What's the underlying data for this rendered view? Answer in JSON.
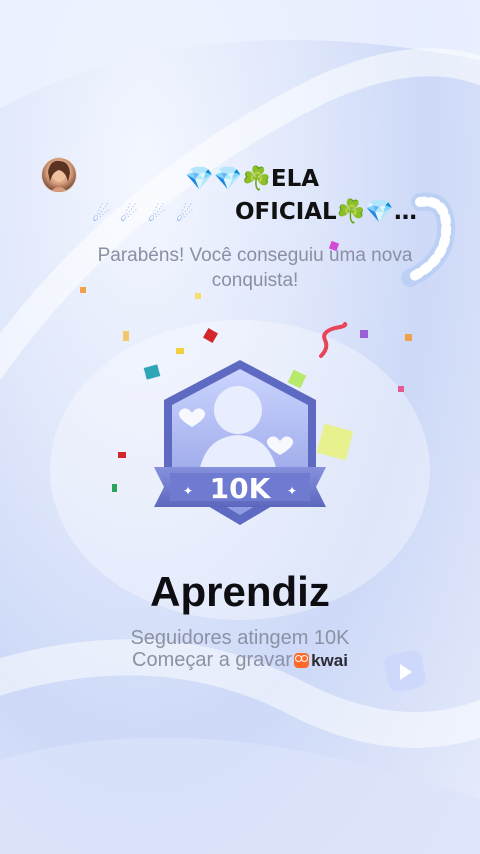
{
  "header": {
    "avatar_alt": "avatar",
    "username_line1": "💎💎☘️ELA",
    "username_line2": "OFICIAL☘️💎…",
    "ice_row": "☄☄☄☄"
  },
  "message": {
    "congrats": "Parabéns! Você conseguiu uma nova conquista!"
  },
  "badge": {
    "label": "10K",
    "icon": "follower-badge-icon"
  },
  "achievement": {
    "title": "Aprendiz",
    "subtitle": "Seguidores atingem 10K",
    "cta": "Começar a gravar",
    "brand": "kwai"
  },
  "colors": {
    "badge_dark": "#6a76c9",
    "badge_light": "#e9eeff",
    "title": "#0d0d12",
    "muted": "#8c91a4"
  }
}
